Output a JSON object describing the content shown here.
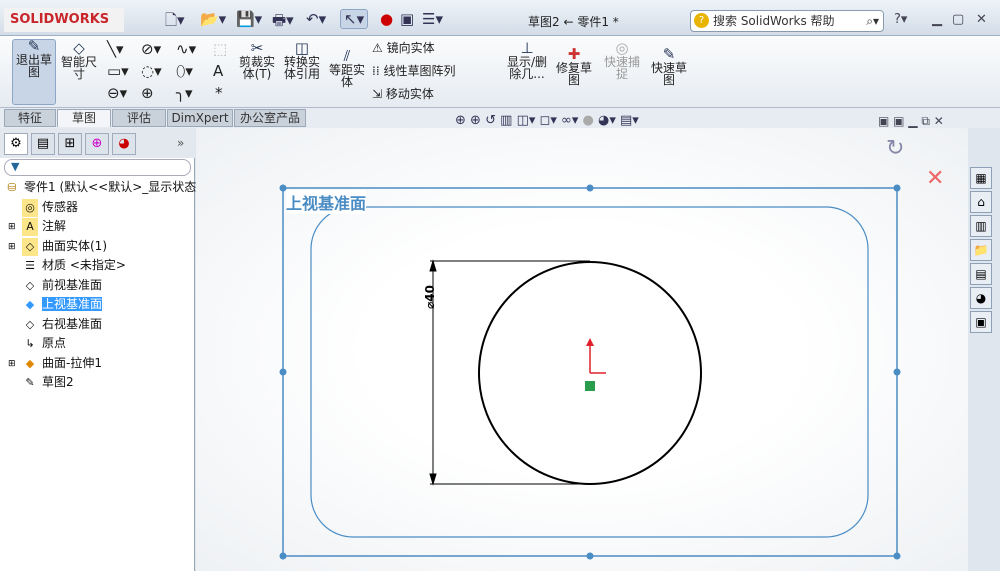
{
  "app": {
    "logo": "SOLIDWORKS",
    "title": "草图2 ← 零件1 *",
    "search_placeholder": "搜索 SolidWorks 帮助"
  },
  "ribbon": {
    "exit_sketch": "退出草图",
    "smart_dim": "智能尺寸",
    "trim": "剪裁实体(T)",
    "convert": "转换实体引用",
    "offset": "等距实体",
    "mirror": "镜向实体",
    "linear_pattern": "线性草图阵列",
    "move": "移动实体",
    "show_delete": "显示/删除几...",
    "repair": "修复草图",
    "quick_snap": "快速捕捉",
    "rapid_sketch": "快速草图"
  },
  "tabs": [
    "特征",
    "草图",
    "评估",
    "DimXpert",
    "办公室产品"
  ],
  "active_tab": 1,
  "tree": {
    "root": "零件1 (默认<<默认>_显示状态",
    "items": [
      "传感器",
      "注解",
      "曲面实体(1)",
      "材质 <未指定>",
      "前视基准面",
      "上视基准面",
      "右视基准面",
      "原点",
      "曲面-拉伸1",
      "草图2"
    ],
    "selected": 5
  },
  "canvas": {
    "plane_label": "上视基准面",
    "dimension": "⌀40"
  },
  "colors": {
    "accent": "#3399ff",
    "plane": "#4a8cc4",
    "origin": "#e0202a"
  }
}
